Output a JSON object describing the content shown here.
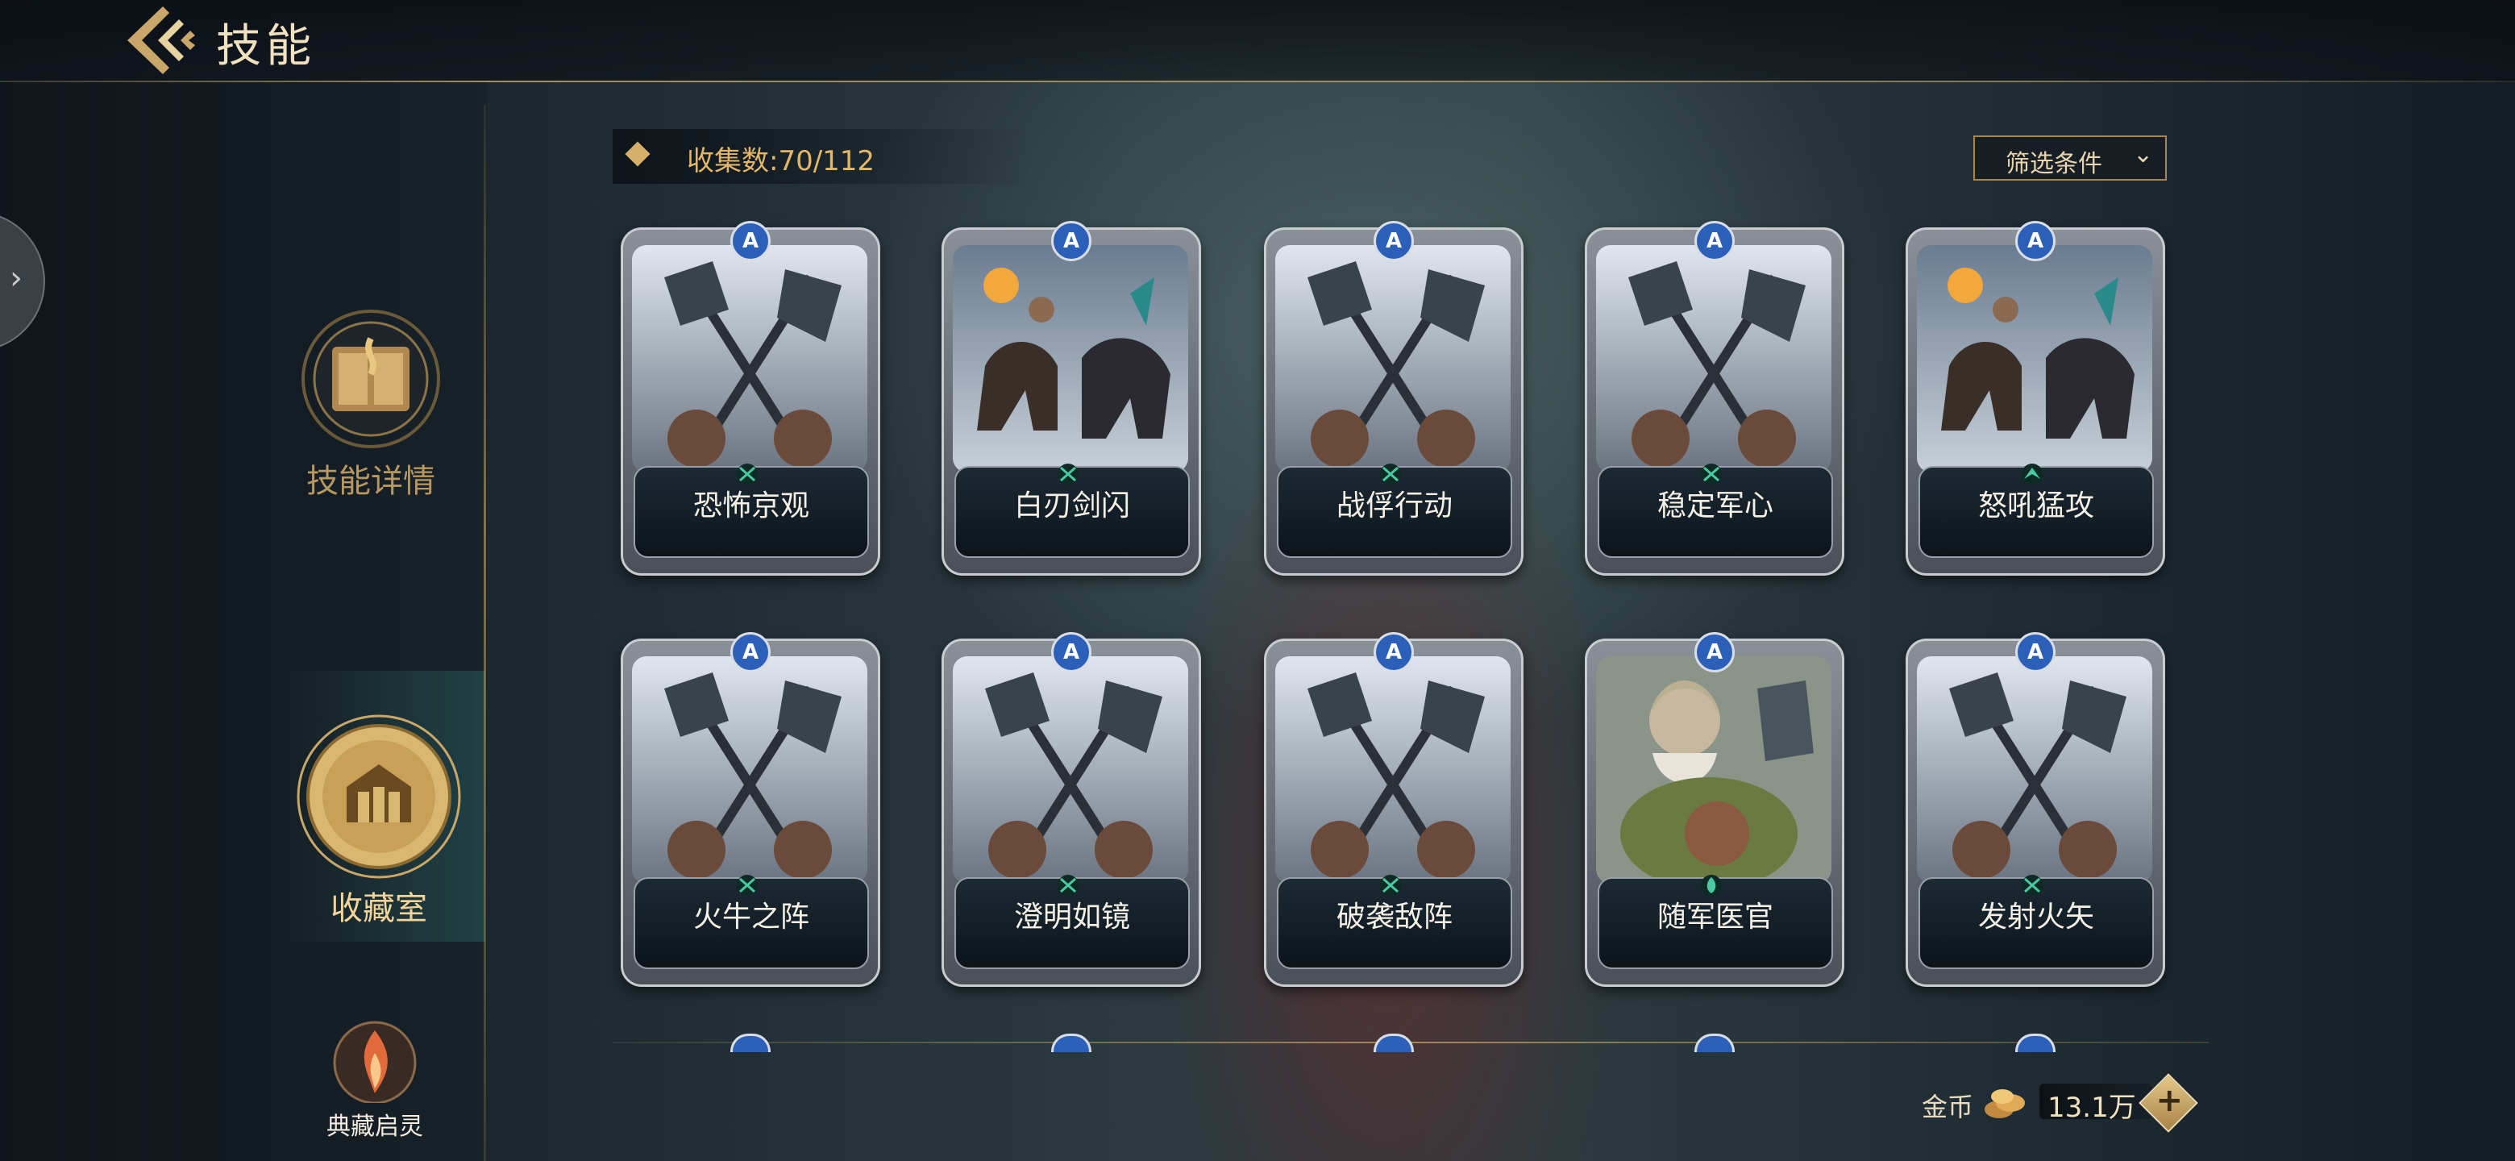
{
  "header": {
    "title": "技能"
  },
  "sidebar": {
    "items": [
      {
        "label": "技能详情",
        "icon": "skill-book-icon",
        "active": false
      },
      {
        "label": "收藏室",
        "icon": "collection-hall-icon",
        "active": true
      },
      {
        "label": "典藏启灵",
        "icon": "flame-spirit-icon",
        "active": false
      }
    ]
  },
  "collection": {
    "counter_text": "收集数:70/112"
  },
  "filter": {
    "label": "筛选条件"
  },
  "cards": [
    {
      "name": "恐怖京观",
      "art": "crossed-axes",
      "emblem": "crossed-weapons-icon"
    },
    {
      "name": "白刃剑闪",
      "art": "cavalry-charge",
      "emblem": "crossed-weapons-icon"
    },
    {
      "name": "战俘行动",
      "art": "crossed-axes",
      "emblem": "crossed-weapons-icon"
    },
    {
      "name": "稳定军心",
      "art": "crossed-axes",
      "emblem": "crossed-weapons-icon"
    },
    {
      "name": "怒吼猛攻",
      "art": "cavalry-charge",
      "emblem": "chevron-emblem-icon"
    },
    {
      "name": "火牛之阵",
      "art": "crossed-axes",
      "emblem": "crossed-weapons-icon"
    },
    {
      "name": "澄明如镜",
      "art": "crossed-axes",
      "emblem": "crossed-weapons-icon"
    },
    {
      "name": "破袭敌阵",
      "art": "crossed-axes",
      "emblem": "crossed-weapons-icon"
    },
    {
      "name": "随军医官",
      "art": "armored-medic",
      "emblem": "medic-emblem-icon"
    },
    {
      "name": "发射火矢",
      "art": "crossed-axes",
      "emblem": "crossed-weapons-icon"
    }
  ],
  "rank_badge_letter": "A",
  "currency": {
    "label": "金币",
    "value": "13.1万",
    "plus": "+"
  },
  "colors": {
    "gold": "#c9a66a",
    "badge_blue": "#2b5fb8",
    "frame_silver": "#c8ccd2"
  }
}
